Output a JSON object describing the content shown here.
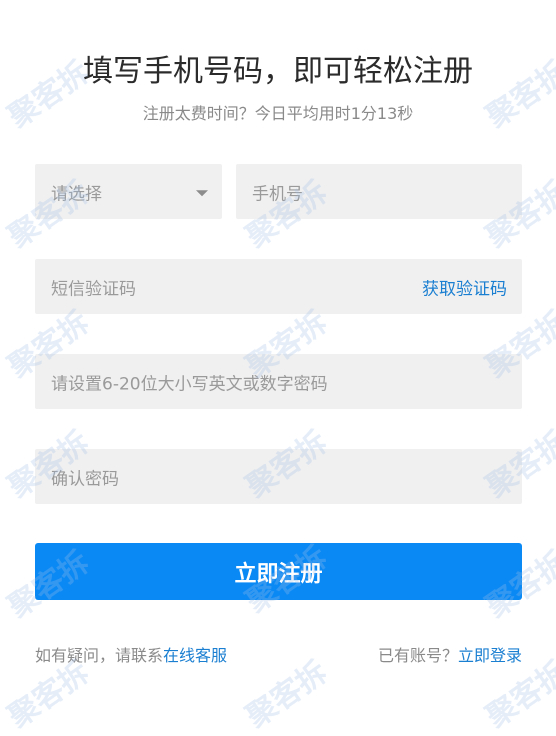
{
  "header": {
    "title": "填写手机号码，即可轻松注册",
    "subtitle": "注册太费时间？今日平均用时1分13秒"
  },
  "form": {
    "region_select": {
      "placeholder": "请选择"
    },
    "phone": {
      "placeholder": "手机号"
    },
    "sms_code": {
      "placeholder": "短信验证码",
      "get_code_label": "获取验证码"
    },
    "password": {
      "placeholder": "请设置6-20位大小写英文或数字密码"
    },
    "confirm_password": {
      "placeholder": "确认密码"
    },
    "submit_label": "立即注册"
  },
  "footer": {
    "help_text": "如有疑问，请联系",
    "help_link": "在线客服",
    "login_text": "已有账号？",
    "login_link": "立即登录"
  },
  "watermark": {
    "text": "聚客拆"
  },
  "colors": {
    "accent": "#0a89f5",
    "link": "#1b7fd1",
    "field_bg": "#f0f0f0"
  }
}
